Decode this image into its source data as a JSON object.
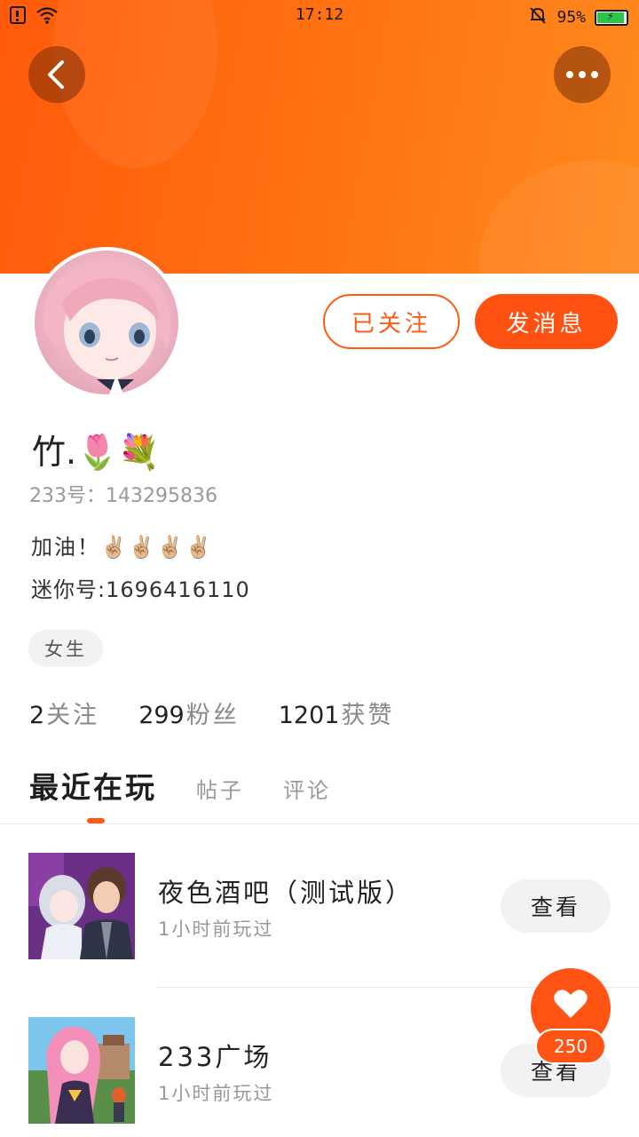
{
  "status_bar": {
    "time": "17:12",
    "battery": "95%",
    "battery_level": 0.95,
    "icons": [
      "sim-icon",
      "wifi-icon",
      "mute-bell-icon",
      "battery-icon"
    ]
  },
  "colors": {
    "accent": "#ff5414",
    "header_start": "#ff5a0a",
    "header_end": "#ff8a1e"
  },
  "profile": {
    "name": "竹.🌷💐",
    "uid": "233号：143295836",
    "bio": "加油！✌🏼✌🏼✌🏼✌🏼",
    "mini_id": "迷你号:1696416110",
    "gender": "女生",
    "follow_label": "已关注",
    "message_label": "发消息"
  },
  "stats": [
    {
      "value": "2",
      "label": "关注"
    },
    {
      "value": "299",
      "label": "粉丝"
    },
    {
      "value": "1201",
      "label": "获赞"
    }
  ],
  "tabs": [
    {
      "label": "最近在玩",
      "active": true
    },
    {
      "label": "帖子",
      "active": false
    },
    {
      "label": "评论",
      "active": false
    }
  ],
  "games": [
    {
      "title": "夜色酒吧（测试版）",
      "subtitle": "1小时前玩过",
      "action": "查看"
    },
    {
      "title": "233广场",
      "subtitle": "1小时前玩过",
      "action": "查看"
    }
  ],
  "like": {
    "count": "250"
  }
}
